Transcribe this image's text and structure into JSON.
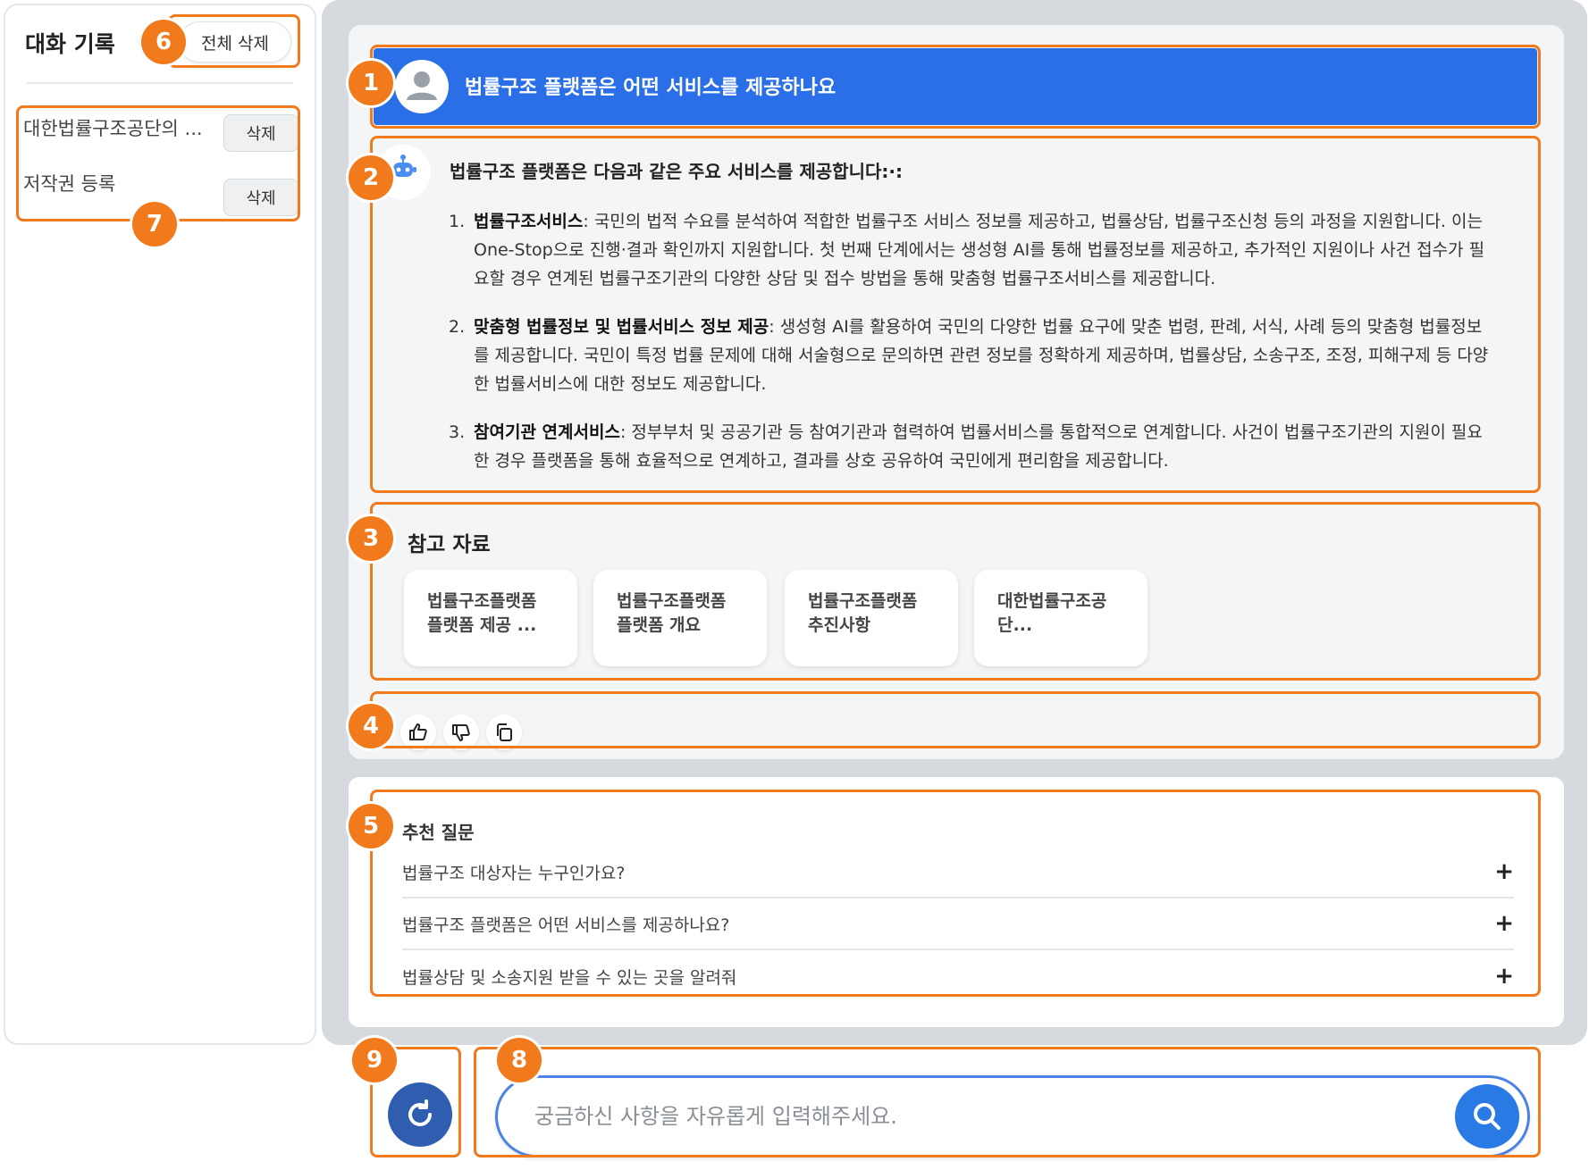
{
  "sidebar": {
    "title": "대화 기록",
    "delete_all_label": "전체 삭제",
    "history": [
      {
        "label": "대한법률구조공단의 ...",
        "delete_label": "삭제"
      },
      {
        "label": "저작권 등록",
        "delete_label": "삭제"
      }
    ]
  },
  "chat": {
    "user_question": "법률구조 플랫폼은 어떤 서비스를 제공하나요",
    "answer_title": "법률구조 플랫폼은 다음과 같은 주요 서비스를 제공합니다:·:",
    "answer_items": [
      {
        "num": "1.",
        "bold": "법률구조서비스",
        "text": ": 국민의 법적 수요를 분석하여 적합한 법률구조 서비스 정보를 제공하고, 법률상담, 법률구조신청 등의 과정을 지원합니다. 이는 One-Stop으로 진행·결과 확인까지 지원합니다. 첫 번째 단계에서는 생성형 AI를 통해 법률정보를 제공하고, 추가적인 지원이나 사건 접수가 필요할 경우 연계된 법률구조기관의 다양한 상담 및 접수 방법을 통해 맞춤형 법률구조서비스를 제공합니다."
      },
      {
        "num": "2.",
        "bold": "맞춤형 법률정보 및 법률서비스 정보 제공",
        "text": ": 생성형 AI를 활용하여 국민의 다양한 법률 요구에 맞춘 법령, 판례, 서식, 사례 등의 맞춤형 법률정보를 제공합니다. 국민이 특정 법률 문제에 대해 서술형으로 문의하면 관련 정보를 정확하게 제공하며, 법률상담, 소송구조, 조정, 피해구제 등 다양한 법률서비스에 대한 정보도 제공합니다."
      },
      {
        "num": "3.",
        "bold": "참여기관 연계서비스",
        "text": ": 정부부처 및 공공기관 등 참여기관과 협력하여 법률서비스를 통합적으로 연계합니다. 사건이 법률구조기관의 지원이 필요한 경우 플랫폼을 통해 효율적으로 연계하고, 결과를 상호 공유하여 국민에게 편리함을 제공합니다."
      }
    ],
    "references_title": "참고 자료",
    "references": [
      {
        "line1": "법률구조플랫폼",
        "line2": "플랫폼 제공 ..."
      },
      {
        "line1": "법률구조플랫폼",
        "line2": "플랫폼 개요"
      },
      {
        "line1": "법률구조플랫폼",
        "line2": "추진사항"
      },
      {
        "line1": "대한법률구조공",
        "line2": "단..."
      }
    ],
    "feedback_icons": [
      "thumbs-up-icon",
      "thumbs-down-icon",
      "copy-icon"
    ]
  },
  "suggestions": {
    "title": "추천 질문",
    "items": [
      {
        "text": "법률구조 대상자는 누구인가요?",
        "icon": "+"
      },
      {
        "text": "법률구조 플랫폼은 어떤 서비스를 제공하나요?",
        "icon": "+"
      },
      {
        "text": "법률상담 및 소송지원 받을 수 있는 곳을 알려줘",
        "icon": "+"
      }
    ]
  },
  "input": {
    "placeholder": "궁금하신 사항을 자유롭게 입력해주세요."
  },
  "annotations": [
    "1",
    "2",
    "3",
    "4",
    "5",
    "6",
    "7",
    "8",
    "9"
  ],
  "colors": {
    "accent": "#2a6fe8",
    "annotation": "#f07a1c",
    "refresh_button": "#2f5eb0",
    "search_button": "#2a7ae6"
  }
}
